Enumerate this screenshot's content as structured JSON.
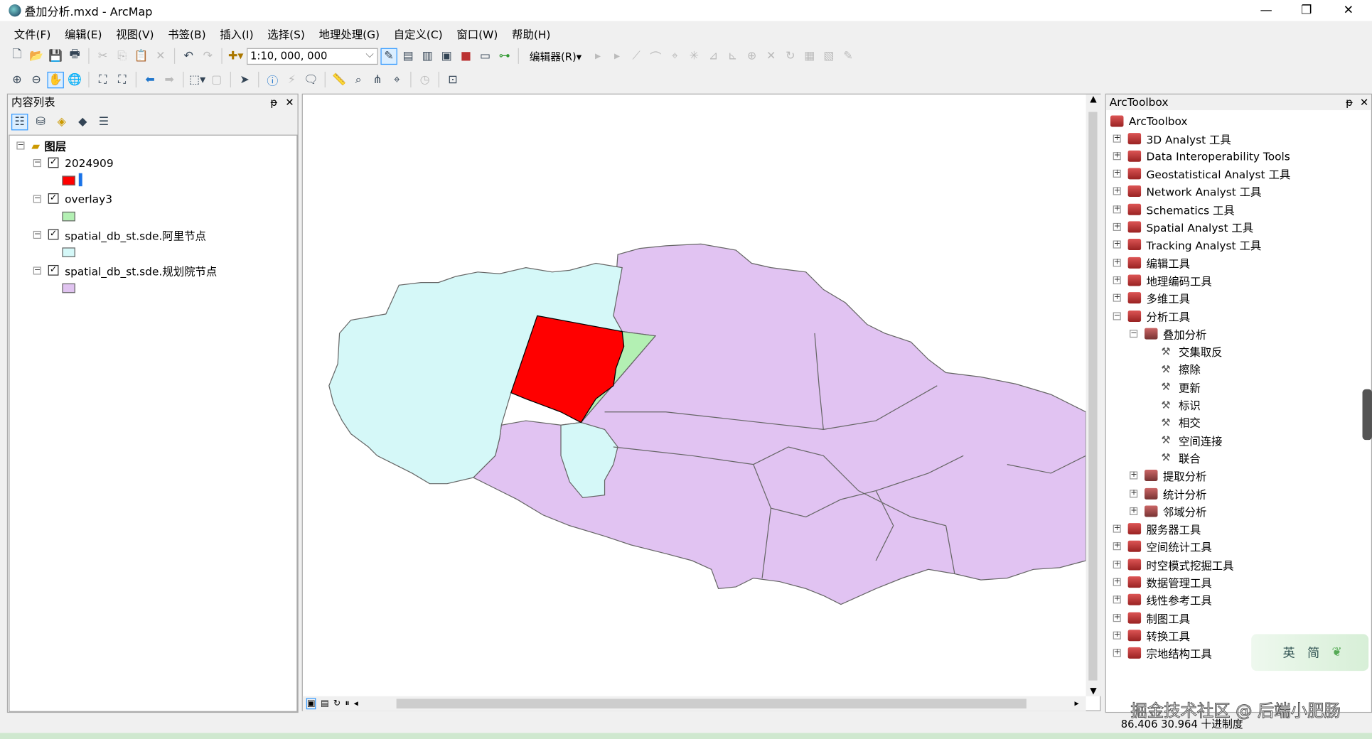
{
  "window": {
    "title": "叠加分析.mxd - ArcMap",
    "minimize": "—",
    "restore": "❐",
    "close": "✕"
  },
  "menu": [
    "文件(F)",
    "编辑(E)",
    "视图(V)",
    "书签(B)",
    "插入(I)",
    "选择(S)",
    "地理处理(G)",
    "自定义(C)",
    "窗口(W)",
    "帮助(H)"
  ],
  "toolbar": {
    "scale": "1:10, 000, 000",
    "editor": "编辑器(R)▾"
  },
  "toc": {
    "title": "内容列表",
    "pin": "ᵽ",
    "close": "✕",
    "root": "图层",
    "layers": [
      {
        "name": "2024909",
        "symbol": "#ff0000"
      },
      {
        "name": "overlay3",
        "symbol": "#b3f0b3"
      },
      {
        "name": "spatial_db_st.sde.阿里节点",
        "symbol": "#d5f8f8"
      },
      {
        "name": "spatial_db_st.sde.规划院节点",
        "symbol": "#e0c3f0"
      }
    ]
  },
  "map": {
    "colors": {
      "cyan": "#d5f8f8",
      "lavender": "#e1c3f2",
      "red": "#ff0000",
      "green": "#b3f0b3",
      "border": "#666666"
    }
  },
  "toolbox": {
    "title": "ArcToolbox",
    "pin": "ᵽ",
    "close": "✕",
    "root": "ArcToolbox",
    "items": [
      {
        "label": "3D Analyst 工具",
        "level": 0,
        "exp": "+"
      },
      {
        "label": "Data Interoperability Tools",
        "level": 0,
        "exp": "+"
      },
      {
        "label": "Geostatistical Analyst 工具",
        "level": 0,
        "exp": "+"
      },
      {
        "label": "Network Analyst 工具",
        "level": 0,
        "exp": "+"
      },
      {
        "label": "Schematics 工具",
        "level": 0,
        "exp": "+"
      },
      {
        "label": "Spatial Analyst 工具",
        "level": 0,
        "exp": "+"
      },
      {
        "label": "Tracking Analyst 工具",
        "level": 0,
        "exp": "+"
      },
      {
        "label": "编辑工具",
        "level": 0,
        "exp": "+"
      },
      {
        "label": "地理编码工具",
        "level": 0,
        "exp": "+"
      },
      {
        "label": "多维工具",
        "level": 0,
        "exp": "+"
      },
      {
        "label": "分析工具",
        "level": 0,
        "exp": "−"
      },
      {
        "label": "叠加分析",
        "level": 1,
        "exp": "−"
      },
      {
        "label": "交集取反",
        "level": 2
      },
      {
        "label": "擦除",
        "level": 2
      },
      {
        "label": "更新",
        "level": 2
      },
      {
        "label": "标识",
        "level": 2
      },
      {
        "label": "相交",
        "level": 2
      },
      {
        "label": "空间连接",
        "level": 2
      },
      {
        "label": "联合",
        "level": 2
      },
      {
        "label": "提取分析",
        "level": 1,
        "exp": "+"
      },
      {
        "label": "统计分析",
        "level": 1,
        "exp": "+"
      },
      {
        "label": "邻域分析",
        "level": 1,
        "exp": "+"
      },
      {
        "label": "服务器工具",
        "level": 0,
        "exp": "+"
      },
      {
        "label": "空间统计工具",
        "level": 0,
        "exp": "+"
      },
      {
        "label": "时空模式挖掘工具",
        "level": 0,
        "exp": "+"
      },
      {
        "label": "数据管理工具",
        "level": 0,
        "exp": "+"
      },
      {
        "label": "线性参考工具",
        "level": 0,
        "exp": "+"
      },
      {
        "label": "制图工具",
        "level": 0,
        "exp": "+"
      },
      {
        "label": "转换工具",
        "level": 0,
        "exp": "+"
      },
      {
        "label": "宗地结构工具",
        "level": 0,
        "exp": "+"
      }
    ]
  },
  "ime": {
    "lang": "英",
    "mode": "简"
  },
  "status": {
    "coords": "86.406  30.964 十进制度"
  },
  "watermark": "掘金技术社区 @ 后端小肥肠"
}
